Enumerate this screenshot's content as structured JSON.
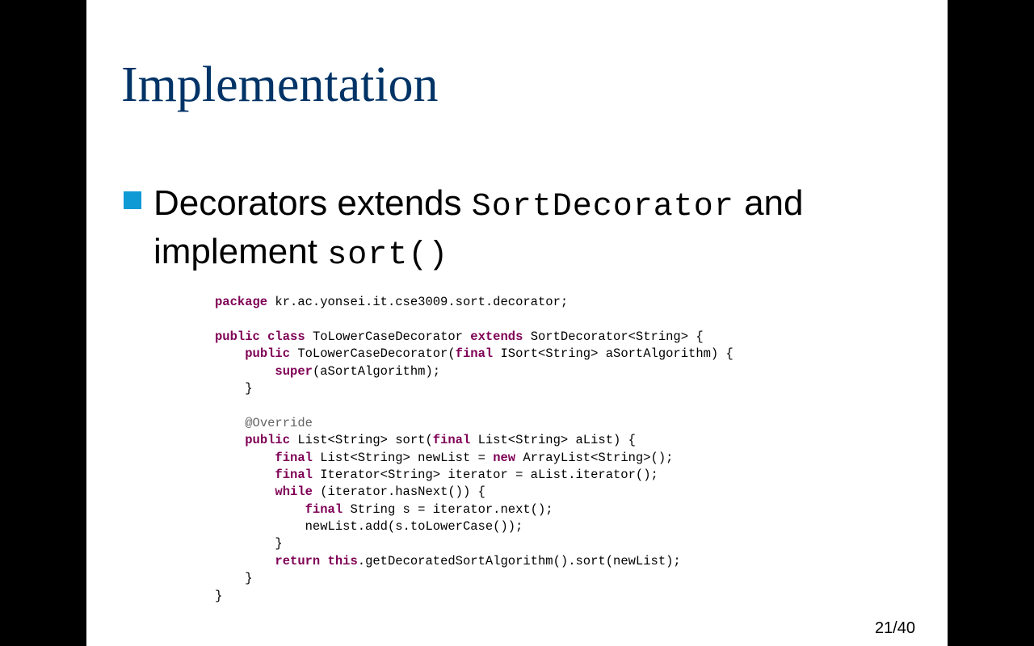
{
  "slide": {
    "title": "Implementation",
    "bullet": {
      "text_1": "Decorators extends",
      "code_1": "SortDecorator",
      "text_2": "and implement",
      "code_2": "sort()"
    },
    "code_lines": [
      [
        {
          "t": "package",
          "k": true
        },
        {
          "t": " kr.ac.yonsei.it.cse3009.sort.decorator;"
        }
      ],
      [],
      [
        {
          "t": "public",
          "k": true
        },
        {
          "t": " "
        },
        {
          "t": "class",
          "k": true
        },
        {
          "t": " ToLowerCaseDecorator "
        },
        {
          "t": "extends",
          "k": true
        },
        {
          "t": " SortDecorator<String> {"
        }
      ],
      [
        {
          "t": "    "
        },
        {
          "t": "public",
          "k": true
        },
        {
          "t": " ToLowerCaseDecorator("
        },
        {
          "t": "final",
          "k": true
        },
        {
          "t": " ISort<String> aSortAlgorithm) {"
        }
      ],
      [
        {
          "t": "        "
        },
        {
          "t": "super",
          "k": true
        },
        {
          "t": "(aSortAlgorithm);"
        }
      ],
      [
        {
          "t": "    }"
        }
      ],
      [],
      [
        {
          "t": "    "
        },
        {
          "t": "@Override",
          "a": true
        }
      ],
      [
        {
          "t": "    "
        },
        {
          "t": "public",
          "k": true
        },
        {
          "t": " List<String> sort("
        },
        {
          "t": "final",
          "k": true
        },
        {
          "t": " List<String> aList) {"
        }
      ],
      [
        {
          "t": "        "
        },
        {
          "t": "final",
          "k": true
        },
        {
          "t": " List<String> newList = "
        },
        {
          "t": "new",
          "k": true
        },
        {
          "t": " ArrayList<String>();"
        }
      ],
      [
        {
          "t": "        "
        },
        {
          "t": "final",
          "k": true
        },
        {
          "t": " Iterator<String> iterator = aList.iterator();"
        }
      ],
      [
        {
          "t": "        "
        },
        {
          "t": "while",
          "k": true
        },
        {
          "t": " (iterator.hasNext()) {"
        }
      ],
      [
        {
          "t": "            "
        },
        {
          "t": "final",
          "k": true
        },
        {
          "t": " String s = iterator.next();"
        }
      ],
      [
        {
          "t": "            newList.add(s.toLowerCase());"
        }
      ],
      [
        {
          "t": "        }"
        }
      ],
      [
        {
          "t": "        "
        },
        {
          "t": "return",
          "k": true
        },
        {
          "t": " "
        },
        {
          "t": "this",
          "k": true
        },
        {
          "t": ".getDecoratedSortAlgorithm().sort(newList);"
        }
      ],
      [
        {
          "t": "    }"
        }
      ],
      [
        {
          "t": "}"
        }
      ]
    ],
    "page_number": "21/40"
  },
  "colors": {
    "title": "#003366",
    "bullet_marker": "#0f9ad6",
    "keyword": "#7f0055",
    "annotation": "#646464"
  }
}
